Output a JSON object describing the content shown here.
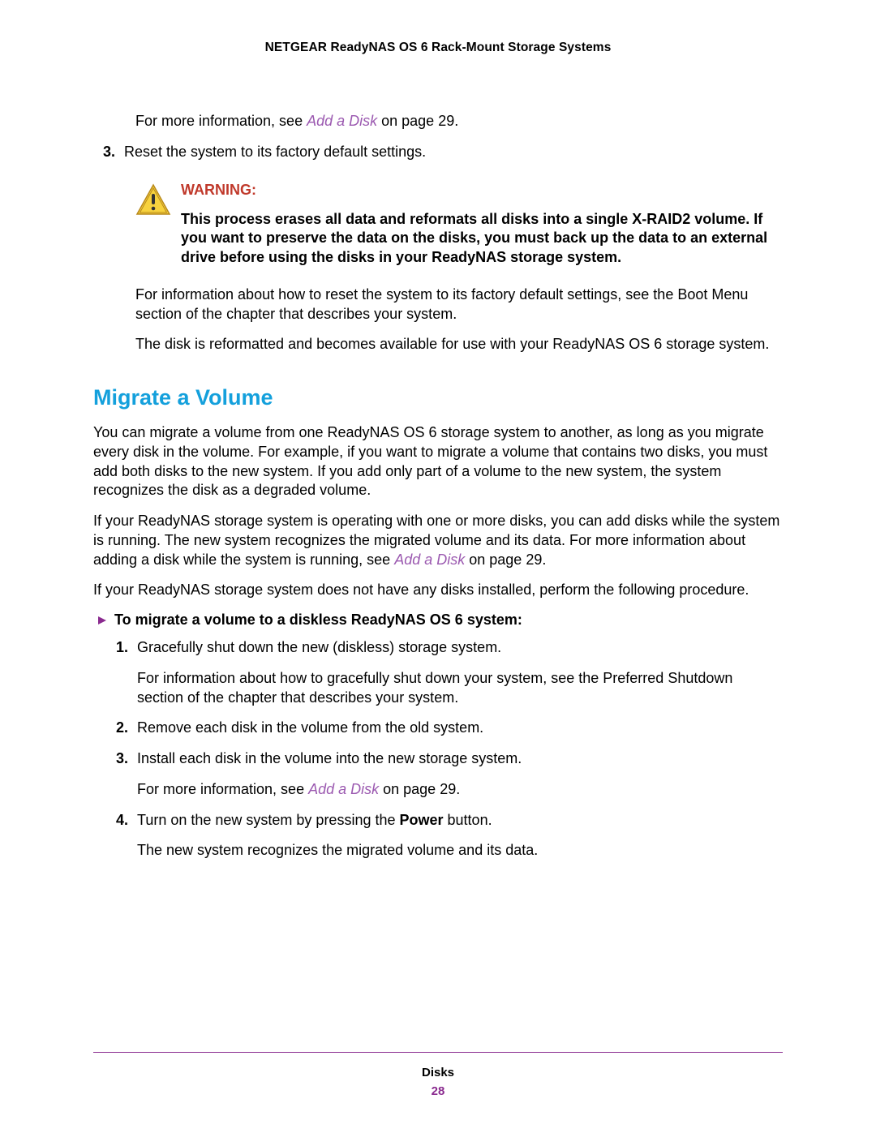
{
  "header": {
    "title": "NETGEAR ReadyNAS OS 6 Rack-Mount Storage Systems"
  },
  "top": {
    "info_prefix": "For more information, see ",
    "info_link": "Add a Disk",
    "info_suffix": " on page 29.",
    "step3_num": "3.",
    "step3_text": "Reset the system to its factory default settings."
  },
  "warning": {
    "label": "WARNING:",
    "body": "This process erases all data and reformats all disks into a single X-RAID2 volume. If you want to preserve the data on the disks, you must back up the data to an external drive before using the disks in your ReadyNAS storage system."
  },
  "after_warning": {
    "p1": "For information about how to reset the system to its factory default settings, see the Boot Menu section of the chapter that describes your system.",
    "p2": "The disk is reformatted and becomes available for use with your ReadyNAS OS 6 storage system."
  },
  "section": {
    "heading": "Migrate a Volume",
    "p1": "You can migrate a volume from one ReadyNAS OS 6 storage system to another, as long as you migrate every disk in the volume. For example, if you want to migrate a volume that contains two disks, you must add both disks to the new system. If you add only part of a volume to the new system, the system recognizes the disk as a degraded volume.",
    "p2_a": "If your ReadyNAS storage system is operating with one or more disks, you can add disks while the system is running. The new system recognizes the migrated volume and its data. For more information about adding a disk while the system is running, see ",
    "p2_link": "Add a Disk",
    "p2_b": " on page 29.",
    "p3": "If your ReadyNAS storage system does not have any disks installed, perform the following procedure."
  },
  "proc": {
    "title": "To migrate a volume to a diskless ReadyNAS OS 6 system:",
    "s1_num": "1.",
    "s1_a": "Gracefully shut down the new (diskless) storage system.",
    "s1_b": "For information about how to gracefully shut down your system, see the Preferred Shutdown section of the chapter that describes your system.",
    "s2_num": "2.",
    "s2_a": "Remove each disk in the volume from the old system.",
    "s3_num": "3.",
    "s3_a": "Install each disk in the volume into the new storage system.",
    "s3_b_prefix": "For more information, see ",
    "s3_b_link": "Add a Disk",
    "s3_b_suffix": " on page 29.",
    "s4_num": "4.",
    "s4_a_prefix": "Turn on the new system by pressing the ",
    "s4_a_bold": "Power",
    "s4_a_suffix": " button.",
    "s4_b": "The new system recognizes the migrated volume and its data."
  },
  "footer": {
    "label": "Disks",
    "page": "28"
  }
}
